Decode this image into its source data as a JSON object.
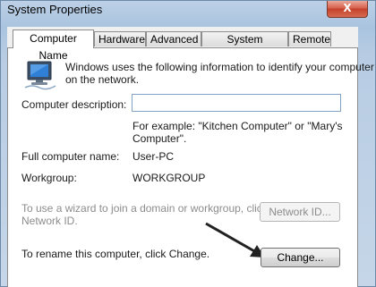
{
  "window": {
    "title": "System Properties",
    "close_label": "X"
  },
  "tabs": [
    {
      "label": "Computer Name"
    },
    {
      "label": "Hardware"
    },
    {
      "label": "Advanced"
    },
    {
      "label": "System Protection"
    },
    {
      "label": "Remote"
    }
  ],
  "panel": {
    "intro_line1": "Windows uses the following information to identify your computer",
    "intro_line2": "on the network.",
    "description_label": "Computer description:",
    "description_value": "",
    "example_line1": "For example: \"Kitchen Computer\" or \"Mary's",
    "example_line2": "Computer\".",
    "full_name_label": "Full computer name:",
    "full_name_value": "User-PC",
    "workgroup_label": "Workgroup:",
    "workgroup_value": "WORKGROUP",
    "wizard_line1": "To use a wizard to join a domain or workgroup, click",
    "wizard_line2": "Network ID.",
    "network_id_button": "Network ID...",
    "rename_text": "To rename this computer, click Change.",
    "change_button": "Change..."
  },
  "icons": {
    "computer": "computer-network-icon",
    "arrow": "arrow-annotation"
  }
}
